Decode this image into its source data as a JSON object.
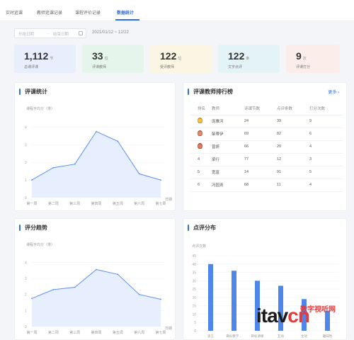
{
  "tabs": [
    "实时追课",
    "教师追课记录",
    "课程评价记录",
    "数据统计"
  ],
  "filter": {
    "start_placeholder": "开始日期",
    "end_placeholder": "结束日期",
    "range": "2021/01/12 ~ 12/22"
  },
  "stats": [
    {
      "value": "1,112",
      "unit": "节",
      "label": "总课评课",
      "bg": "#e8eefc"
    },
    {
      "value": "33",
      "unit": "位",
      "label": "评课教师",
      "bg": "#e5f5ec"
    },
    {
      "value": "122",
      "unit": "位",
      "label": "受评教师",
      "bg": "#fbf5e3"
    },
    {
      "value": "122",
      "unit": "条",
      "label": "文字点评",
      "bg": "#e3f3f6"
    },
    {
      "value": "9",
      "unit": "次",
      "label": "评课打分",
      "bg": "#fbeeea"
    }
  ],
  "cards": {
    "stats_title": "评课统计",
    "rank_title": "评课教师排行榜",
    "more": "更多 ›",
    "trend_title": "评分趋势",
    "dist_title": "点评分布"
  },
  "colors": {
    "accent": "#2f6fe4",
    "line": "#5b8ff0",
    "bar": "#4f86ec"
  },
  "rank_table": {
    "headers": [
      "排名",
      "教师",
      "评课节数",
      "点评条数",
      "打分次数"
    ],
    "rows": [
      {
        "rank": "1",
        "medal": "gold",
        "name": "庞雅河",
        "lessons": "24",
        "comments": "39",
        "scores": "9"
      },
      {
        "rank": "2",
        "medal": "silver",
        "name": "柴蒂伊",
        "lessons": "69",
        "comments": "82",
        "scores": "6"
      },
      {
        "rank": "3",
        "medal": "bronze",
        "name": "曾妍",
        "lessons": "66",
        "comments": "20",
        "scores": "4"
      },
      {
        "rank": "4",
        "medal": "",
        "name": "梁行",
        "lessons": "77",
        "comments": "12",
        "scores": "3"
      },
      {
        "rank": "5",
        "medal": "",
        "name": "宽富",
        "lessons": "14",
        "comments": "91",
        "scores": "5"
      },
      {
        "rank": "6",
        "medal": "",
        "name": "冯园尧",
        "lessons": "68",
        "comments": "11",
        "scores": "4"
      }
    ]
  },
  "chart_data": [
    {
      "type": "area",
      "title": "评课统计",
      "ylabel": "课程平均分（排）",
      "xlabel": "日期",
      "categories": [
        "第一周",
        "第二周",
        "第三周",
        "第四周",
        "第五周",
        "第六周",
        "第七周"
      ],
      "values": [
        1.0,
        1.7,
        1.9,
        3.75,
        3.2,
        1.35,
        1.0
      ],
      "yticks": [
        "0",
        "1",
        "2",
        "3",
        "4"
      ],
      "ylim": [
        0,
        4.5
      ]
    },
    {
      "type": "area",
      "title": "评分趋势",
      "ylabel": "课程平均分（排）",
      "xlabel": "日期",
      "categories": [
        "第一周",
        "第二周",
        "第三周",
        "第四周",
        "第五周",
        "第六周",
        "第七周"
      ],
      "values": [
        1.75,
        2.3,
        2.45,
        3.55,
        3.25,
        2.0,
        1.7
      ],
      "yticks": [
        "0",
        "1",
        "2",
        "3",
        "4"
      ],
      "ylim": [
        0,
        4.5
      ]
    },
    {
      "type": "bar",
      "title": "点评分布",
      "ylabel": "点评次数",
      "categories": [
        "语言",
        "目标教学…",
        "目标清晰",
        "互动",
        "生动",
        "趣味性"
      ],
      "values": [
        40,
        36,
        30,
        27,
        19,
        12
      ],
      "yticks": [
        "0",
        "5",
        "10",
        "15",
        "20",
        "25",
        "30",
        "35",
        "40",
        "45"
      ],
      "ylim": [
        0,
        45
      ]
    }
  ],
  "watermark": {
    "brand_a": "itav",
    "brand_b": "cn",
    "top": "数字视听网"
  }
}
